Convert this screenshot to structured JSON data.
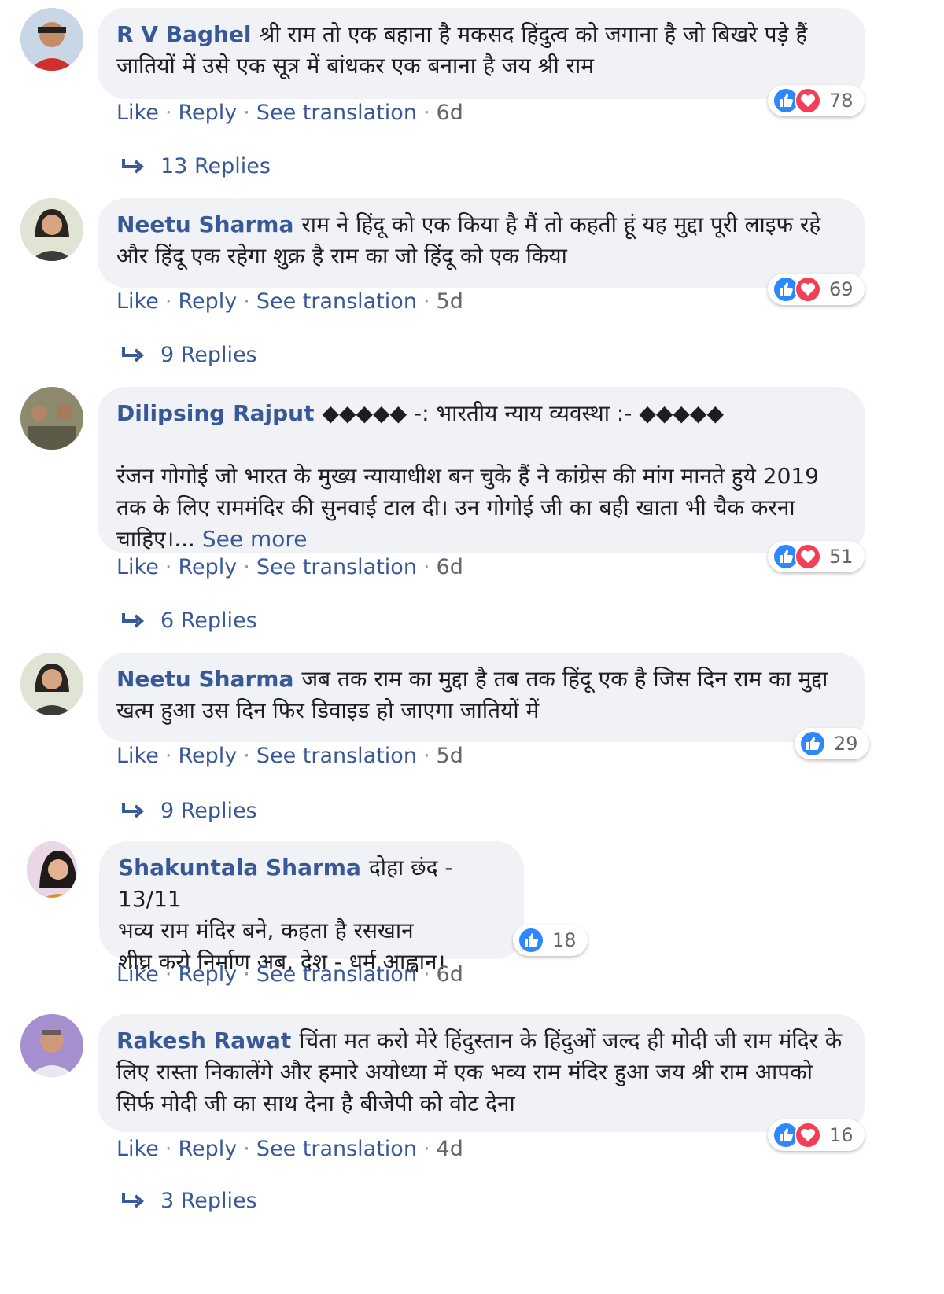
{
  "colors": {
    "author": "#385898",
    "link": "#385898",
    "meta": "#65676b",
    "bubble": "#f0f2f5",
    "like_blue": "#2d88ff",
    "love_red": "#f33e58"
  },
  "comments": [
    {
      "author": "R V Baghel",
      "text": "श्री राम तो एक बहाना है मकसद हिंदुत्व को जगाना है जो बिखरे पड़े हैं जातियों में उसे एक सूत्र में बांधकर एक बनाना है जय श्री राम",
      "see_more": "",
      "reactions": {
        "icons": [
          "like-icon",
          "love-icon"
        ],
        "count": "78"
      },
      "actions": {
        "like": "Like",
        "reply": "Reply",
        "translate": "See translation",
        "time": "6d"
      },
      "replies": "13 Replies"
    },
    {
      "author": "Neetu Sharma",
      "text": "राम ने हिंदू को एक किया है मैं तो कहती हूं यह मुद्दा पूरी लाइफ रहे और हिंदू एक रहेगा शुक्र है राम का जो हिंदू को एक किया",
      "see_more": "",
      "reactions": {
        "icons": [
          "like-icon",
          "love-icon"
        ],
        "count": "69"
      },
      "actions": {
        "like": "Like",
        "reply": "Reply",
        "translate": "See translation",
        "time": "5d"
      },
      "replies": "9 Replies"
    },
    {
      "author": "Dilipsing Rajput",
      "text": "◆◆◆◆◆ -: भारतीय न्याय व्यवस्था :- ◆◆◆◆◆\n\nरंजन गोगोई जो भारत के मुख्य न्यायाधीश बन चुके हैं ने कांग्रेस की मांग मानते हुये 2019 तक के लिए राममंदिर की सुनवाई टाल दी। उन गोगोई जी का बही खाता भी चैक करना चाहिए।...",
      "see_more": "See more",
      "reactions": {
        "icons": [
          "like-icon",
          "love-icon"
        ],
        "count": "51"
      },
      "actions": {
        "like": "Like",
        "reply": "Reply",
        "translate": "See translation",
        "time": "6d"
      },
      "replies": "6 Replies"
    },
    {
      "author": "Neetu Sharma",
      "text": "जब तक राम का मुद्दा है तब तक हिंदू एक है जिस दिन राम का मुद्दा खत्म हुआ उस दिन फिर डिवाइड हो जाएगा जातियों में",
      "see_more": "",
      "reactions": {
        "icons": [
          "like-icon"
        ],
        "count": "29"
      },
      "actions": {
        "like": "Like",
        "reply": "Reply",
        "translate": "See translation",
        "time": "5d"
      },
      "replies": "9 Replies"
    },
    {
      "author": "Shakuntala Sharma",
      "text": "दोहा छंद - 13/11\nभव्य राम मंदिर बने, कहता है रसखान\nशीघ्र करो निर्माण अब, देश - धर्म आह्वान।",
      "see_more": "",
      "reactions": {
        "icons": [
          "like-icon"
        ],
        "count": "18"
      },
      "actions": {
        "like": "Like",
        "reply": "Reply",
        "translate": "See translation",
        "time": "6d"
      },
      "replies": ""
    },
    {
      "author": "Rakesh Rawat",
      "text": "चिंता मत करो मेरे हिंदुस्तान के हिंदुओं जल्द ही मोदी जी राम मंदिर के लिए रास्ता निकालेंगे और हमारे अयोध्या में एक भव्य राम मंदिर हुआ जय श्री राम आपको सिर्फ मोदी जी का साथ देना है बीजेपी को वोट देना",
      "see_more": "",
      "reactions": {
        "icons": [
          "like-icon",
          "love-icon"
        ],
        "count": "16"
      },
      "actions": {
        "like": "Like",
        "reply": "Reply",
        "translate": "See translation",
        "time": "4d"
      },
      "replies": "3 Replies"
    }
  ]
}
